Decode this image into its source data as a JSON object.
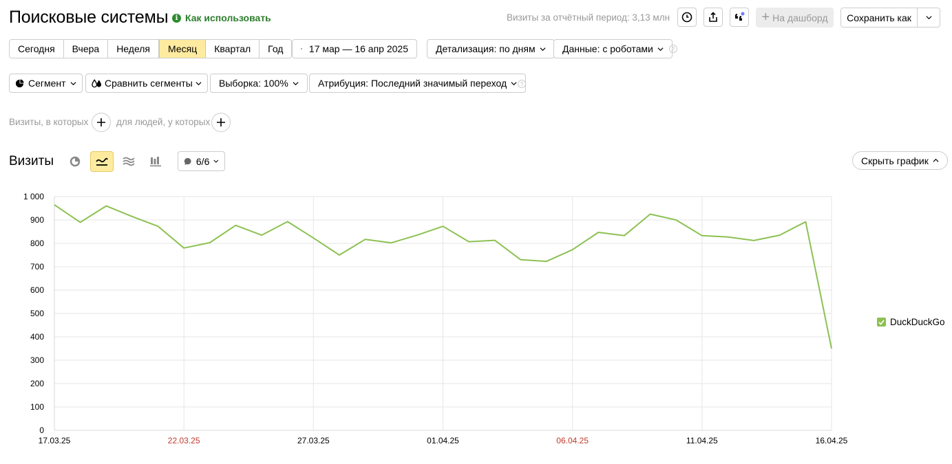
{
  "header": {
    "title": "Поисковые системы",
    "how_to_use": "Как использовать",
    "visits_total": "Визиты за отчётный период: 3,13 млн",
    "to_dashboard": "На дашборд",
    "save_as": "Сохранить как"
  },
  "period": {
    "items": [
      "Сегодня",
      "Вчера",
      "Неделя",
      "Месяц",
      "Квартал",
      "Год"
    ],
    "active": "Месяц",
    "date_range": "17 мар — 16 апр 2025",
    "detail": "Детализация: по дням",
    "data": "Данные: с роботами"
  },
  "segments": {
    "segment": "Сегмент",
    "compare": "Сравнить сегменты",
    "sample": "Выборка: 100%",
    "attribution": "Атрибуция: Последний значимый переход"
  },
  "filters": {
    "visits_where": "Визиты, в которых",
    "people_where": "для людей, у которых"
  },
  "chart_panel": {
    "title": "Визиты",
    "series_count": "6/6",
    "hide_chart": "Скрыть график"
  },
  "colors": {
    "accent_yellow": "#ffeba0",
    "line_green": "#8cc152",
    "link_green": "#2e7d2e",
    "weekend_red": "#c0392b"
  },
  "chart_data": {
    "type": "line",
    "title": "",
    "xlabel": "",
    "ylabel": "",
    "ylim": [
      0,
      1000
    ],
    "yticks": [
      "0",
      "100",
      "200",
      "300",
      "400",
      "500",
      "600",
      "700",
      "800",
      "900",
      "1 000"
    ],
    "xtick_labels": [
      {
        "label": "17.03.25",
        "index": 0,
        "weekend": false
      },
      {
        "label": "22.03.25",
        "index": 5,
        "weekend": true
      },
      {
        "label": "27.03.25",
        "index": 10,
        "weekend": false
      },
      {
        "label": "01.04.25",
        "index": 15,
        "weekend": false
      },
      {
        "label": "06.04.25",
        "index": 20,
        "weekend": true
      },
      {
        "label": "11.04.25",
        "index": 25,
        "weekend": false
      },
      {
        "label": "16.04.25",
        "index": 30,
        "weekend": false
      }
    ],
    "series": [
      {
        "name": "DuckDuckGo",
        "color": "#8cc152",
        "values": [
          965,
          890,
          960,
          915,
          873,
          780,
          803,
          877,
          835,
          893,
          823,
          750,
          817,
          802,
          835,
          873,
          807,
          813,
          730,
          723,
          773,
          847,
          833,
          925,
          900,
          833,
          827,
          812,
          835,
          892,
          350
        ]
      }
    ],
    "grid": true,
    "legend_position": "right"
  }
}
